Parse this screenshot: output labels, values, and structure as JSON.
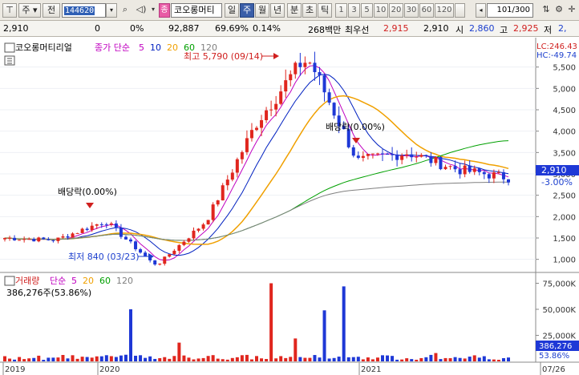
{
  "toolbar": {
    "market_select": "주",
    "prev_label": "전",
    "code": "144620",
    "name": "코오롱머티",
    "period_tabs": [
      "일",
      "주",
      "월",
      "년",
      "분",
      "초",
      "틱"
    ],
    "active_period": "주",
    "interval_buttons": [
      "1",
      "3",
      "5",
      "10",
      "20",
      "30",
      "60",
      "120"
    ],
    "count": "101/300",
    "pink_label": "종"
  },
  "quote": {
    "price": "2,910",
    "change": "0",
    "change_pct": "0%",
    "volume": "92,887",
    "vol_ratio": "69.69%",
    "turnover": "0.14%",
    "amount": "268백만",
    "prior_label": "최우선",
    "ask": "2,915",
    "bid": "2,910",
    "open_label": "시",
    "open": "2,860",
    "high_label": "고",
    "high": "2,925",
    "low_label": "저",
    "low": "2,"
  },
  "price_panel": {
    "legend_name": "코오롱머티리얼",
    "legend_ma_label": "종가 단순",
    "ma_periods": [
      "5",
      "10",
      "20",
      "60",
      "120"
    ],
    "lc_label": "LC:246.43",
    "hc_label": "HC:-49.74",
    "max_label": "최고 5,790 (09/14)",
    "min_label": "최저 840 (03/23)",
    "div1_label": "배당락(0.00%)",
    "div2_label": "배당락(0.00%)",
    "price_tag": "2,910",
    "pct_tag": "-3.00%",
    "y_ticks": [
      "5,500",
      "5,000",
      "4,500",
      "4,000",
      "3,500",
      "3,000",
      "2,500",
      "2,000",
      "1,500",
      "1,000"
    ]
  },
  "volume_panel": {
    "legend_name": "거래량",
    "legend_ma_label": "단순",
    "ma_periods": [
      "5",
      "20",
      "60",
      "120"
    ],
    "sub_label": "386,276주(53.86%)",
    "volume_tag": "386,276",
    "volume_pct_tag": "53.86%",
    "y_ticks": [
      "75,000K",
      "50,000K",
      "25,000K"
    ]
  },
  "x_axis": {
    "labels": [
      "2019",
      "2020",
      "2021",
      "07/26"
    ]
  },
  "colors": {
    "up": "#e0261e",
    "down": "#1e38d6",
    "ma5": "#c000c0",
    "ma10": "#0020c0",
    "ma20": "#f0a000",
    "ma60": "#00a000",
    "ma120": "#808080"
  },
  "chart_data": {
    "type": "candlestick",
    "title": "코오롱머티리얼",
    "weekly_close_points": [
      {
        "x": "2019-07",
        "close": 1500
      },
      {
        "x": "2019-10",
        "close": 1450
      },
      {
        "x": "2020-01",
        "close": 1900
      },
      {
        "x": "2020-03",
        "close": 840
      },
      {
        "x": "2020-06",
        "close": 1900
      },
      {
        "x": "2020-08",
        "close": 4200
      },
      {
        "x": "2020-09",
        "close": 5790
      },
      {
        "x": "2020-11",
        "close": 3300
      },
      {
        "x": "2021-01",
        "close": 3500
      },
      {
        "x": "2021-04",
        "close": 3100
      },
      {
        "x": "2021-07",
        "close": 2910
      }
    ],
    "ylim": [
      750,
      5850
    ],
    "volume_ylim": [
      0,
      80000
    ]
  }
}
